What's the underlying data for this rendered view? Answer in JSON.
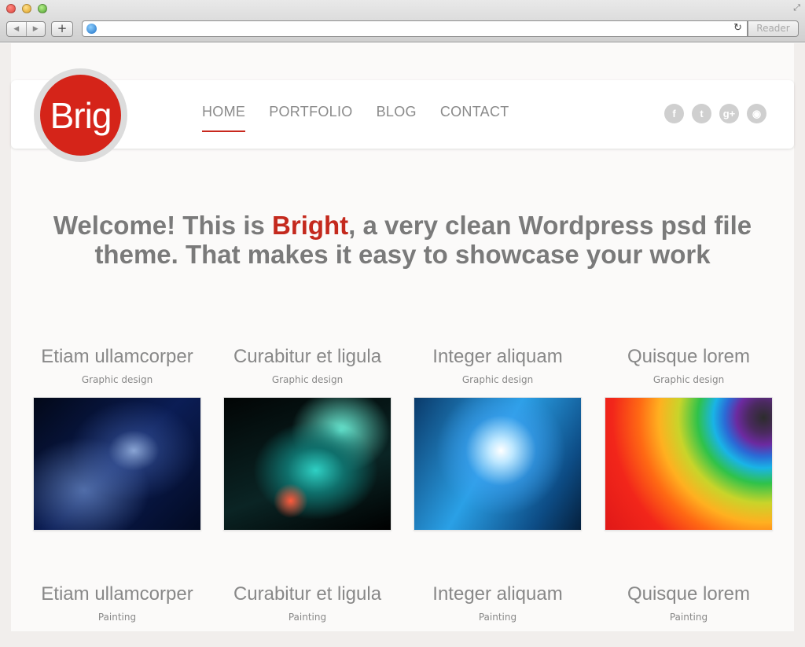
{
  "browser": {
    "back_label": "◀",
    "forward_label": "▶",
    "add_label": "+",
    "reload_label": "↻",
    "reader_label": "Reader",
    "resize_label": "⤢"
  },
  "site": {
    "logo_text": "Brig",
    "nav": [
      {
        "label": "HOME",
        "active": true
      },
      {
        "label": "PORTFOLIO",
        "active": false
      },
      {
        "label": "BLOG",
        "active": false
      },
      {
        "label": "CONTACT",
        "active": false
      }
    ],
    "social": [
      {
        "icon": "facebook-icon",
        "glyph": "f"
      },
      {
        "icon": "twitter-icon",
        "glyph": "t"
      },
      {
        "icon": "google-plus-icon",
        "glyph": "g+"
      },
      {
        "icon": "rss-icon",
        "glyph": "◉"
      }
    ],
    "welcome": {
      "before": "Welcome! This is ",
      "brand": "Bright",
      "after": ", a very clean Wordpress psd file theme. That makes it easy to showcase your work"
    },
    "accent_color": "#c4291d"
  },
  "portfolio_row1": [
    {
      "title": "Etiam ullamcorper",
      "category": "Graphic design"
    },
    {
      "title": "Curabitur et ligula",
      "category": "Graphic design"
    },
    {
      "title": "Integer aliquam",
      "category": "Graphic design"
    },
    {
      "title": "Quisque lorem",
      "category": "Graphic design"
    }
  ],
  "portfolio_row2": [
    {
      "title": "Etiam ullamcorper",
      "category": "Painting"
    },
    {
      "title": "Curabitur et ligula",
      "category": "Painting"
    },
    {
      "title": "Integer aliquam",
      "category": "Painting"
    },
    {
      "title": "Quisque lorem",
      "category": "Painting"
    }
  ]
}
